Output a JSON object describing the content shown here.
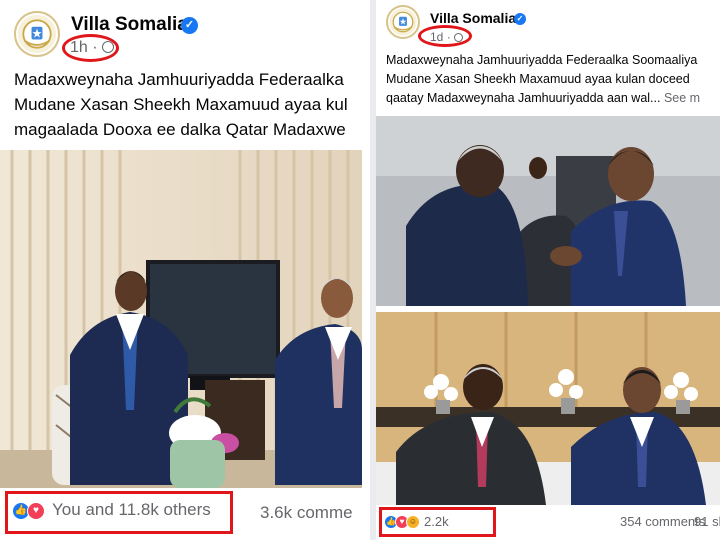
{
  "left_post": {
    "page_name": "Villa Somalia",
    "timestamp": "1h",
    "separator": "·",
    "caption_lines": [
      "Madaxweynaha Jamhuuriyadda Federaalka",
      "Mudane Xasan Sheekh Maxamuud ayaa kul",
      "magaalada Dooxa ee dalka Qatar Madaxwe"
    ],
    "reactions_text": "You and 11.8k others",
    "comments_text": "3.6k comme"
  },
  "right_post": {
    "page_name": "Villa Somalia",
    "timestamp": "1d",
    "separator": "·",
    "caption_lines": [
      "Madaxweynaha Jamhuuriyadda Federaalka Soomaaliya",
      "Mudane Xasan Sheekh Maxamuud ayaa kulan doceed",
      "qaatay Madaxweynaha Jamhuuriyadda aan wal..."
    ],
    "see_more": "See m",
    "reactions_count": "2.2k",
    "comments_text": "354 comments",
    "shares_text": "91 sl"
  },
  "icons": {
    "verified": "verified-checkmark-icon",
    "like": "like-reaction-icon",
    "love": "love-reaction-icon",
    "haha": "haha-reaction-icon",
    "globe": "globe-icon"
  },
  "colors": {
    "highlight": "#e0161b",
    "facebook_blue": "#1877f2",
    "love_red": "#f33e58",
    "meta_gray": "#65676b"
  }
}
